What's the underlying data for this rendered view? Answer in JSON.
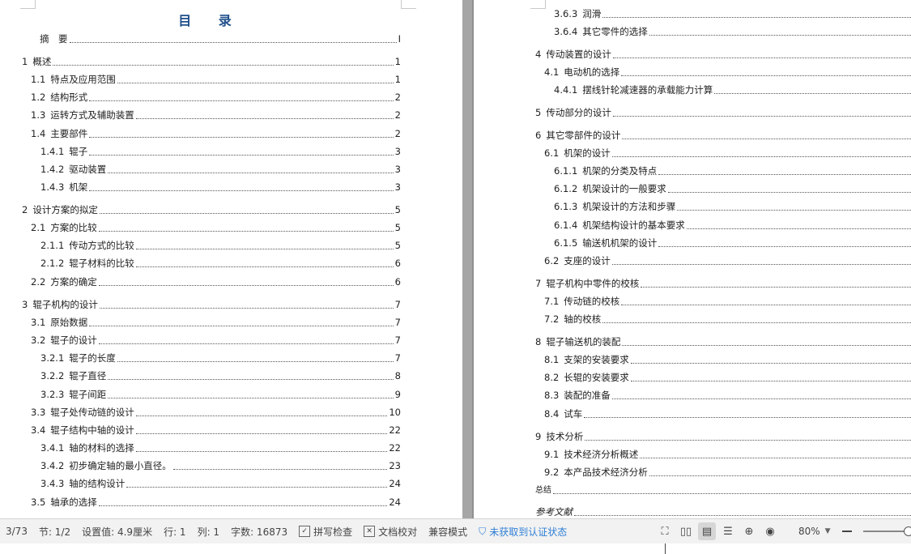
{
  "left_page": {
    "title": "目 录",
    "entries": [
      {
        "num": "",
        "label": "摘　要",
        "page": "I"
      },
      {
        "num": "1",
        "label": "概述",
        "page": "1"
      },
      {
        "num": "1.1",
        "label": "特点及应用范围",
        "page": "1"
      },
      {
        "num": "1.2",
        "label": "结构形式",
        "page": "2"
      },
      {
        "num": "1.3",
        "label": "运转方式及辅助装置",
        "page": "2"
      },
      {
        "num": "1.4",
        "label": "主要部件",
        "page": "2"
      },
      {
        "num": "1.4.1",
        "label": "辊子",
        "page": "3"
      },
      {
        "num": "1.4.2",
        "label": "驱动装置",
        "page": "3"
      },
      {
        "num": "1.4.3",
        "label": "机架",
        "page": "3"
      },
      {
        "num": "2",
        "label": "设计方案的拟定",
        "page": "5"
      },
      {
        "num": "2.1",
        "label": "方案的比较",
        "page": "5"
      },
      {
        "num": "2.1.1",
        "label": "传动方式的比较",
        "page": "5"
      },
      {
        "num": "2.1.2",
        "label": "辊子材料的比较",
        "page": "6"
      },
      {
        "num": "2.2",
        "label": "方案的确定",
        "page": "6"
      },
      {
        "num": "3",
        "label": "辊子机构的设计",
        "page": "7"
      },
      {
        "num": "3.1",
        "label": "原始数据",
        "page": "7"
      },
      {
        "num": "3.2",
        "label": "辊子的设计",
        "page": "7"
      },
      {
        "num": "3.2.1",
        "label": "辊子的长度",
        "page": "7"
      },
      {
        "num": "3.2.2",
        "label": "辊子直径",
        "page": "8"
      },
      {
        "num": "3.2.3",
        "label": "辊子间距",
        "page": "9"
      },
      {
        "num": "3.3",
        "label": "辊子处传动链的设计",
        "page": "10"
      },
      {
        "num": "3.4",
        "label": "辊子结构中轴的设计",
        "page": "22"
      },
      {
        "num": "3.4.1",
        "label": "轴的材料的选择",
        "page": "22"
      },
      {
        "num": "3.4.2",
        "label": "初步确定轴的最小直径。",
        "page": "23"
      },
      {
        "num": "3.4.3",
        "label": "轴的结构设计",
        "page": "24"
      },
      {
        "num": "3.5",
        "label": "轴承的选择",
        "page": "24"
      }
    ]
  },
  "right_page": {
    "entries": [
      {
        "num": "3.6.3",
        "label": "润滑",
        "page": ""
      },
      {
        "num": "3.6.4",
        "label": "其它零件的选择",
        "page": ""
      },
      {
        "num": "4",
        "label": "传动装置的设计",
        "page": ""
      },
      {
        "num": "4.1",
        "label": "电动机的选择",
        "page": ""
      },
      {
        "num": "4.4.1",
        "label": "摆线针轮减速器的承载能力计算",
        "page": ""
      },
      {
        "num": "5",
        "label": "传动部分的设计",
        "page": ""
      },
      {
        "num": "6",
        "label": "其它零部件的设计",
        "page": ""
      },
      {
        "num": "6.1",
        "label": "机架的设计",
        "page": ""
      },
      {
        "num": "6.1.1",
        "label": "机架的分类及特点",
        "page": ""
      },
      {
        "num": "6.1.2",
        "label": "机架设计的一般要求",
        "page": ""
      },
      {
        "num": "6.1.3",
        "label": "机架设计的方法和步骤",
        "page": ""
      },
      {
        "num": "6.1.4",
        "label": "机架结构设计的基本要求",
        "page": ""
      },
      {
        "num": "6.1.5",
        "label": "输送机机架的设计",
        "page": ""
      },
      {
        "num": "6.2",
        "label": "支座的设计",
        "page": ""
      },
      {
        "num": "7",
        "label": "辊子机构中零件的校核",
        "page": ""
      },
      {
        "num": "7.1",
        "label": "传动链的校核",
        "page": ""
      },
      {
        "num": "7.2",
        "label": "轴的校核",
        "page": ""
      },
      {
        "num": "8",
        "label": "辊子输送机的装配",
        "page": ""
      },
      {
        "num": "8.1",
        "label": "支架的安装要求",
        "page": ""
      },
      {
        "num": "8.2",
        "label": "长辊的安装要求",
        "page": ""
      },
      {
        "num": "8.3",
        "label": "装配的准备",
        "page": ""
      },
      {
        "num": "8.4",
        "label": "试车",
        "page": ""
      },
      {
        "num": "9",
        "label": "技术分析",
        "page": ""
      },
      {
        "num": "9.1",
        "label": "技术经济分析概述",
        "page": ""
      },
      {
        "num": "9.2",
        "label": "本产品技术经济分析",
        "page": ""
      },
      {
        "num": "",
        "label": "总结",
        "page": ""
      },
      {
        "num": "",
        "label": "参考文献",
        "page": ""
      }
    ]
  },
  "status_bar": {
    "page_counter": "3/73",
    "section": "节: 1/2",
    "setting": "设置值: 4.9厘米",
    "row": "行: 1",
    "col": "列: 1",
    "word_count": "字数: 16873",
    "spell_check": "拼写检查",
    "doc_proof": "文档校对",
    "compat_mode": "兼容模式",
    "cert_status": "未获取到认证状态",
    "zoom": "80%",
    "accent_color": "#2f7fd6"
  }
}
